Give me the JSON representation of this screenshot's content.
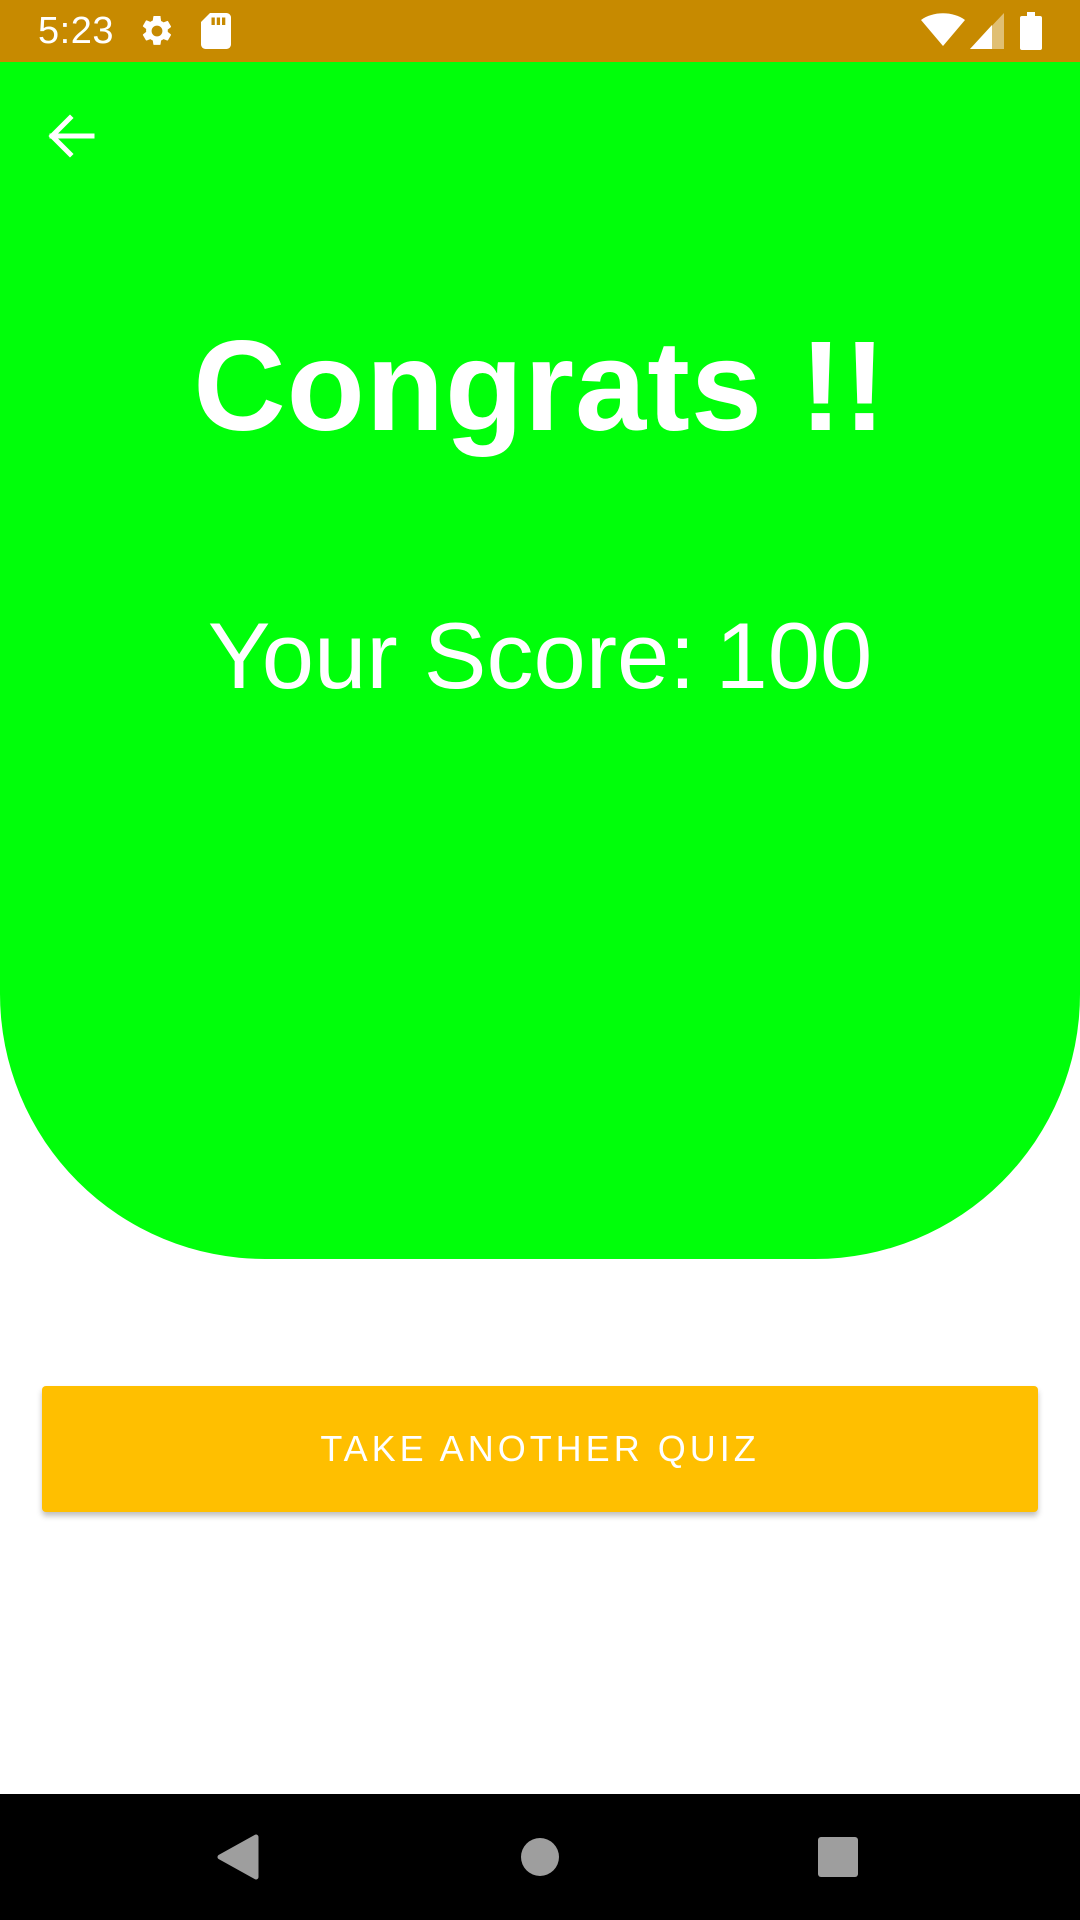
{
  "status_bar": {
    "time": "5:23",
    "background": "#c78a00",
    "icons": [
      "gear-icon",
      "sd-card-icon",
      "wifi-icon",
      "cellular-signal-icon",
      "battery-icon"
    ]
  },
  "result": {
    "title": "Congrats !!",
    "score_label": "Your Score:",
    "score_value": "100",
    "panel_color": "#00ff0a"
  },
  "actions": {
    "take_another_quiz_label": "TAKE ANOTHER QUIZ",
    "button_color": "#ffbf00"
  },
  "navigation": {
    "back_icon": "arrow-left-icon",
    "system_icons": [
      "triangle-back-icon",
      "circle-home-icon",
      "square-recents-icon"
    ]
  }
}
